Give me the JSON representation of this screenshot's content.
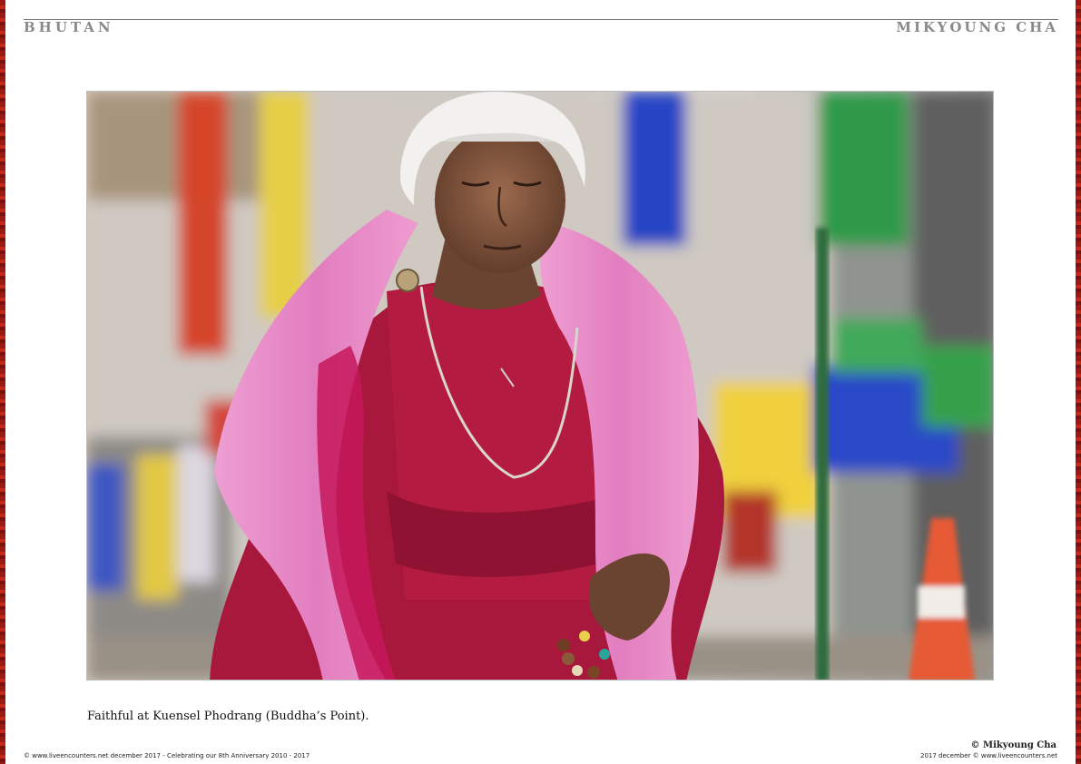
{
  "header": {
    "section": "BHUTAN",
    "author": "MIKYOUNG CHA"
  },
  "photo": {
    "caption": "Faithful at Kuensel Phodrang (Buddha’s Point)."
  },
  "credit": "© Mikyoung Cha",
  "footer": {
    "left": "© www.liveencounters.net  december 2017 - Celebrating our 8th Anniversary 2010 - 2017",
    "right": "2017 december  © www.liveencounters.net"
  },
  "colors": {
    "border": "#c8281c",
    "header_text": "#8a8a8a",
    "robe": "#a8173c",
    "shawl": "#e58fc6"
  }
}
